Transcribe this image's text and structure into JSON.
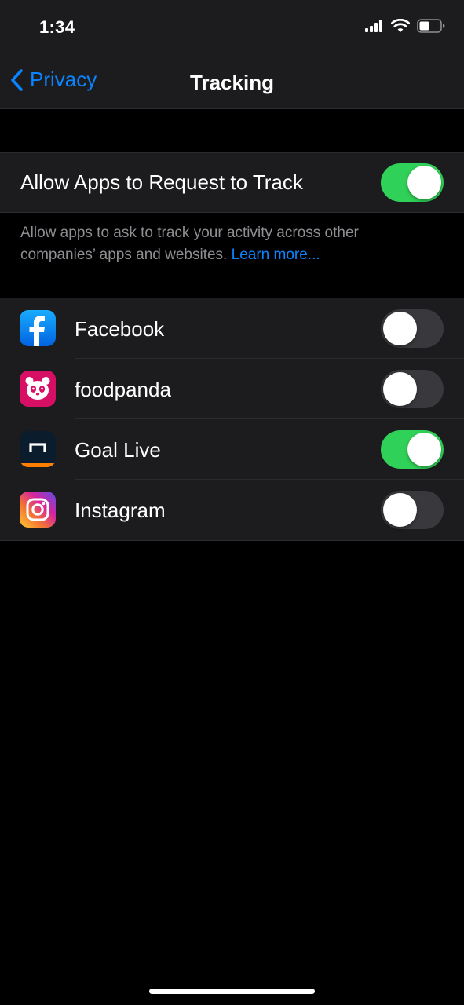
{
  "status_bar": {
    "time": "1:34"
  },
  "nav": {
    "back_label": "Privacy",
    "title": "Tracking"
  },
  "master_toggle": {
    "label": "Allow Apps to Request to Track",
    "on": true
  },
  "footnote": {
    "text": "Allow apps to ask to track your activity across other companies’ apps and websites.",
    "link": "Learn more..."
  },
  "apps": [
    {
      "name": "Facebook",
      "icon": "facebook-app-icon",
      "on": false
    },
    {
      "name": "foodpanda",
      "icon": "foodpanda-app-icon",
      "on": false
    },
    {
      "name": "Goal Live",
      "icon": "goal-live-app-icon",
      "on": true
    },
    {
      "name": "Instagram",
      "icon": "instagram-app-icon",
      "on": false
    }
  ],
  "colors": {
    "accent": "#0a84ff",
    "toggle_on": "#30d158",
    "toggle_off": "#39393d",
    "background": "#000000",
    "cell": "#1c1c1e"
  }
}
